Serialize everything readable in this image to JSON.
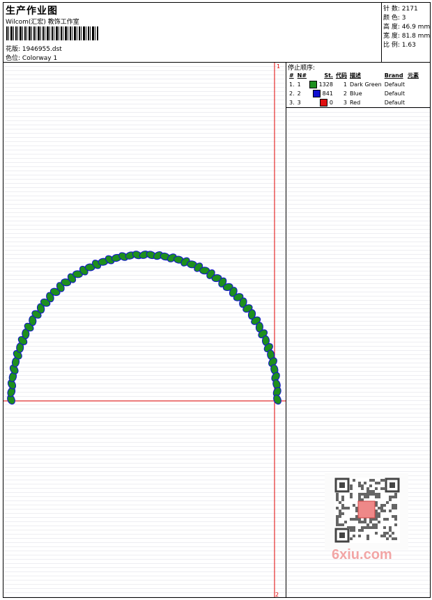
{
  "header": {
    "title": "生产作业图",
    "company": "Wilcom(汇宏) 教饰工作室",
    "design_label": "花版:",
    "design_value": "1946955.dst",
    "colorway_label": "色位:",
    "colorway_value": "Colorway 1"
  },
  "stats": [
    {
      "label": "针 数:",
      "value": "2171"
    },
    {
      "label": "颜 色:",
      "value": "3"
    },
    {
      "label": "高 度:",
      "value": "46.9 mm"
    },
    {
      "label": "宽 度:",
      "value": "81.8 mm"
    },
    {
      "label": "比 例:",
      "value": "1.63"
    }
  ],
  "stop_sequence": {
    "heading": "停止顺序:",
    "columns": [
      "#",
      "N#",
      "St.",
      "代码",
      "描述",
      "Brand",
      "元素"
    ],
    "rows": [
      {
        "idx": "1.",
        "n": "1",
        "color": "#1e8f1e",
        "stitches": "1328",
        "code": "1",
        "desc": "Dark Green",
        "brand": "Default"
      },
      {
        "idx": "2.",
        "n": "2",
        "color": "#1010d0",
        "stitches": "841",
        "code": "2",
        "desc": "Blue",
        "brand": "Default"
      },
      {
        "idx": "3.",
        "n": "3",
        "color": "#e01010",
        "stitches": "0",
        "code": "3",
        "desc": "Red",
        "brand": "Default"
      }
    ]
  },
  "markers": {
    "top": "1",
    "bottom": "2"
  },
  "watermark": "6xiu.com",
  "colors": {
    "guide": "#e00000",
    "green": "#1e8f1e",
    "blue": "#1010d0"
  }
}
